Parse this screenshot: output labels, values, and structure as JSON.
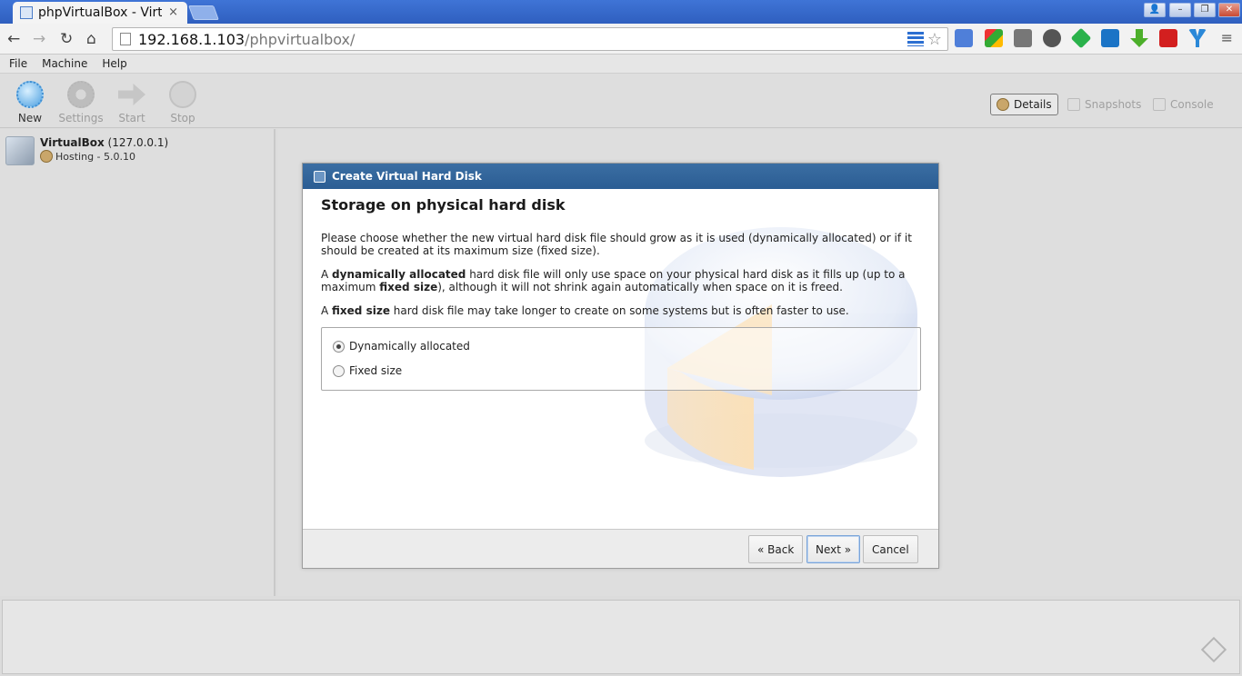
{
  "browser": {
    "tab_title": "phpVirtualBox - Virt",
    "tab_close": "×",
    "url_host": "192.168.1.103",
    "url_path": "/phpvirtualbox/",
    "nav": {
      "back": "←",
      "forward": "→",
      "reload": "↻",
      "home": "⌂"
    },
    "star": "☆",
    "menu": "≡",
    "window_buttons": {
      "user": "👤",
      "minimize": "–",
      "restore": "❐",
      "close": "✕"
    }
  },
  "menubar": {
    "items": [
      "File",
      "Machine",
      "Help"
    ]
  },
  "toolbar": {
    "tools": [
      {
        "label": "New",
        "active": true
      },
      {
        "label": "Settings",
        "active": false
      },
      {
        "label": "Start",
        "active": false
      },
      {
        "label": "Stop",
        "active": false
      }
    ],
    "views": [
      {
        "label": "Details",
        "active": true
      },
      {
        "label": "Snapshots",
        "active": false
      },
      {
        "label": "Console",
        "active": false
      }
    ]
  },
  "host": {
    "name": "VirtualBox",
    "address": " (127.0.0.1)",
    "sub": "Hosting - 5.0.10"
  },
  "dialog": {
    "title": "Create Virtual Hard Disk",
    "heading": "Storage on physical hard disk",
    "para1": "Please choose whether the new virtual hard disk file should grow as it is used (dynamically allocated) or if it should be created at its maximum size (fixed size).",
    "para2": {
      "a": "A ",
      "b1": "dynamically allocated",
      "c": " hard disk file will only use space on your physical hard disk as it fills up (up to a maximum ",
      "b2": "fixed size",
      "d": "), although it will not shrink again automatically when space on it is freed."
    },
    "para3": {
      "a": "A ",
      "b": "fixed size",
      "c": " hard disk file may take longer to create on some systems but is often faster to use."
    },
    "options": [
      {
        "label": "Dynamically allocated",
        "checked": true
      },
      {
        "label": "Fixed size",
        "checked": false
      }
    ],
    "buttons": {
      "back": "« Back",
      "next": "Next »",
      "cancel": "Cancel"
    }
  },
  "colors": {
    "dialog_title_bg": "#2b5d93",
    "browser_titlebar": "#2f5fbf"
  }
}
